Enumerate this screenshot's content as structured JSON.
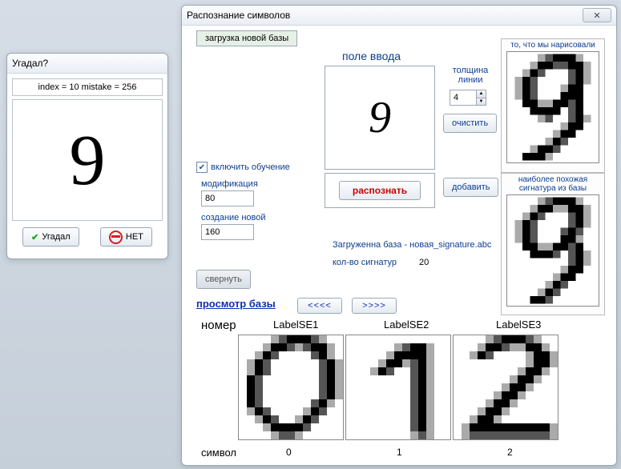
{
  "dlg_small": {
    "title": "Угадал?",
    "status": "index = 10  mistake = 256",
    "digit": "9",
    "yes_label": "Угадал",
    "no_label": "НЕТ"
  },
  "dlg_main": {
    "title": "Распознание символов",
    "close_glyph": "✕",
    "tab_label": "загрузка новой базы",
    "input_title": "поле ввода",
    "thickness_label": "толщина линии",
    "thickness_value": "4",
    "clear_label": "очистить",
    "add_label": "добавить",
    "train_label": "включить обучение",
    "mod_label": "модификация",
    "mod_value": "80",
    "new_label": "создание новой",
    "new_value": "160",
    "recognize_label": "распознать",
    "loaded_label": "Загруженна база - новая_signature.abc",
    "count_label": "кол-во сигнатур",
    "count_value": "20",
    "collapse_label": "свернуть",
    "drawn_caption": "то, что мы нарисовали",
    "match_caption": "наиболее похожая сигнатура из базы",
    "viewer_link": "просмотр базы",
    "nav_prev": "<<<<",
    "nav_next": ">>>>",
    "hdr_num": "номер",
    "hdr_l1": "LabelSE1",
    "hdr_l2": "LabelSE2",
    "hdr_l3": "LabelSE3",
    "sym_label": "символ",
    "sym_vals": [
      "0",
      "1",
      "2"
    ]
  }
}
